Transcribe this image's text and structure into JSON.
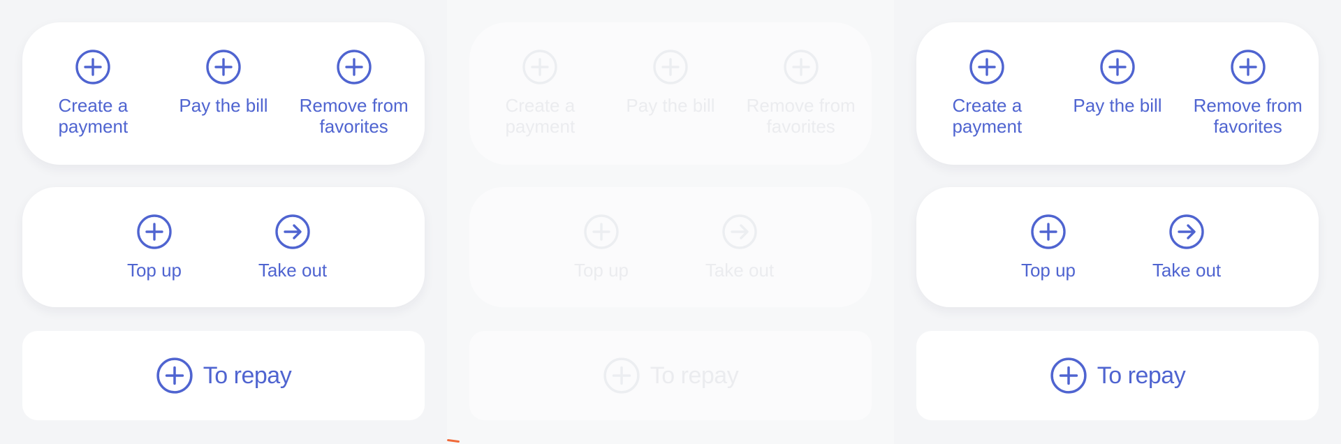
{
  "colors": {
    "accent": "#4f64d0",
    "disabled": "#ebecef",
    "card_bg": "#ffffff",
    "page_bg": "#f4f5f7"
  },
  "columns": [
    {
      "state": "active",
      "actions_row_1": [
        {
          "label": "Create a payment",
          "icon": "plus-circle-icon"
        },
        {
          "label": "Pay the bill",
          "icon": "plus-circle-icon"
        },
        {
          "label": "Remove from favorites",
          "icon": "plus-circle-icon"
        }
      ],
      "actions_row_2": [
        {
          "label": "Top up",
          "icon": "plus-circle-icon"
        },
        {
          "label": "Take out",
          "icon": "arrow-right-circle-icon"
        }
      ],
      "repay": {
        "label": "To repay",
        "icon": "plus-circle-icon"
      }
    },
    {
      "state": "disabled",
      "actions_row_1": [
        {
          "label": "Create a payment",
          "icon": "plus-circle-icon"
        },
        {
          "label": "Pay the bill",
          "icon": "plus-circle-icon"
        },
        {
          "label": "Remove from favorites",
          "icon": "plus-circle-icon"
        }
      ],
      "actions_row_2": [
        {
          "label": "Top up",
          "icon": "plus-circle-icon"
        },
        {
          "label": "Take out",
          "icon": "arrow-right-circle-icon"
        }
      ],
      "repay": {
        "label": "To repay",
        "icon": "plus-circle-icon"
      }
    },
    {
      "state": "active",
      "actions_row_1": [
        {
          "label": "Create a payment",
          "icon": "plus-circle-icon"
        },
        {
          "label": "Pay the bill",
          "icon": "plus-circle-icon"
        },
        {
          "label": "Remove from favorites",
          "icon": "plus-circle-icon"
        }
      ],
      "actions_row_2": [
        {
          "label": "Top up",
          "icon": "plus-circle-icon"
        },
        {
          "label": "Take out",
          "icon": "arrow-right-circle-icon"
        }
      ],
      "repay": {
        "label": "To repay",
        "icon": "plus-circle-icon"
      }
    }
  ]
}
